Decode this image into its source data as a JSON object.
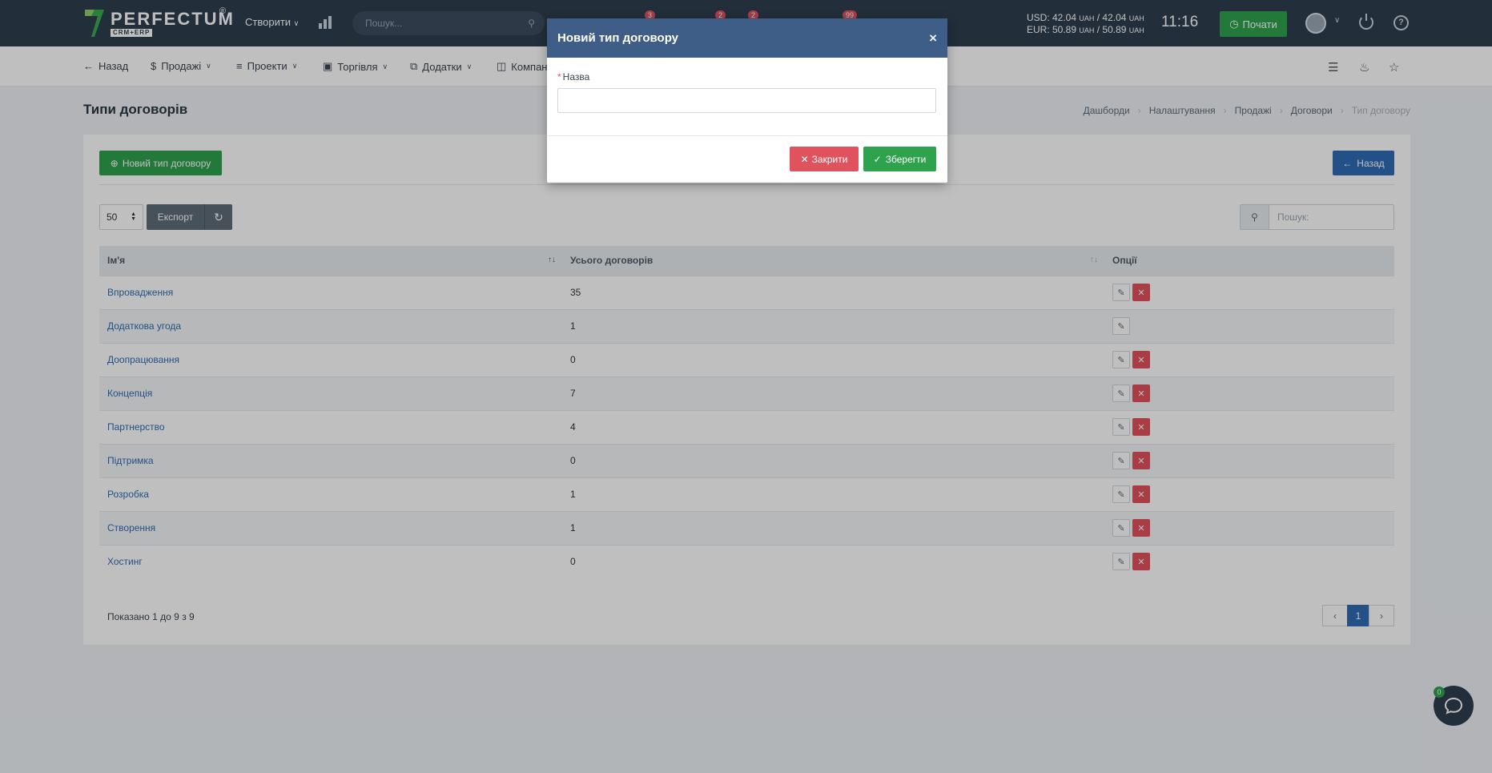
{
  "topbar": {
    "brand": "PERFECTUM",
    "brand_sub": "CRM+ERP",
    "brand_reg": "®",
    "create_label": "Створити",
    "search_placeholder": "Пошук...",
    "badges": [
      "3",
      "2",
      "2",
      "99"
    ],
    "rates": {
      "usd": "USD: 42.04",
      "usd_to": "/ 42.04",
      "eur": "EUR: 50.89",
      "eur_to": "/ 50.89",
      "currency": "UAH"
    },
    "clock": "11:16",
    "start_label": "Почати"
  },
  "navbar": {
    "back_label": "Назад",
    "items": [
      "Продажі",
      "Проекти",
      "Торгівля",
      "Додатки",
      "Компан"
    ]
  },
  "page": {
    "title": "Типи договорів",
    "breadcrumb": [
      "Дашборди",
      "Налаштування",
      "Продажі",
      "Договори",
      "Тип договору"
    ]
  },
  "panel": {
    "new_button_label": "Новий тип договору",
    "back_button_label": "Назад",
    "page_length": "50",
    "export_label": "Експорт",
    "search_placeholder": "Пошук:",
    "columns": [
      "Ім'я",
      "Усього договорів",
      "Опції"
    ],
    "rows": [
      {
        "name": "Впровадження",
        "total": "35",
        "deletable": true
      },
      {
        "name": "Додаткова угода",
        "total": "1",
        "deletable": false
      },
      {
        "name": "Доопрацювання",
        "total": "0",
        "deletable": true
      },
      {
        "name": "Концепція",
        "total": "7",
        "deletable": true
      },
      {
        "name": "Партнерство",
        "total": "4",
        "deletable": true
      },
      {
        "name": "Підтримка",
        "total": "0",
        "deletable": true
      },
      {
        "name": "Розробка",
        "total": "1",
        "deletable": true
      },
      {
        "name": "Створення",
        "total": "1",
        "deletable": true
      },
      {
        "name": "Хостинг",
        "total": "0",
        "deletable": true
      }
    ],
    "shown_text": "Показано 1 до 9 з 9",
    "current_page": "1"
  },
  "chat": {
    "badge": "0"
  },
  "modal": {
    "title": "Новий тип договору",
    "close_symbol": "×",
    "field_required": "*",
    "field_label": "Назва",
    "field_value": "",
    "cancel_label": "Закрити",
    "save_label": "Зберегти"
  },
  "colors": {
    "topbar": "#2e3e4e",
    "modal_header": "#3f5e87",
    "success": "#2fa24e",
    "danger": "#e0525e",
    "primary": "#2f6db5"
  }
}
